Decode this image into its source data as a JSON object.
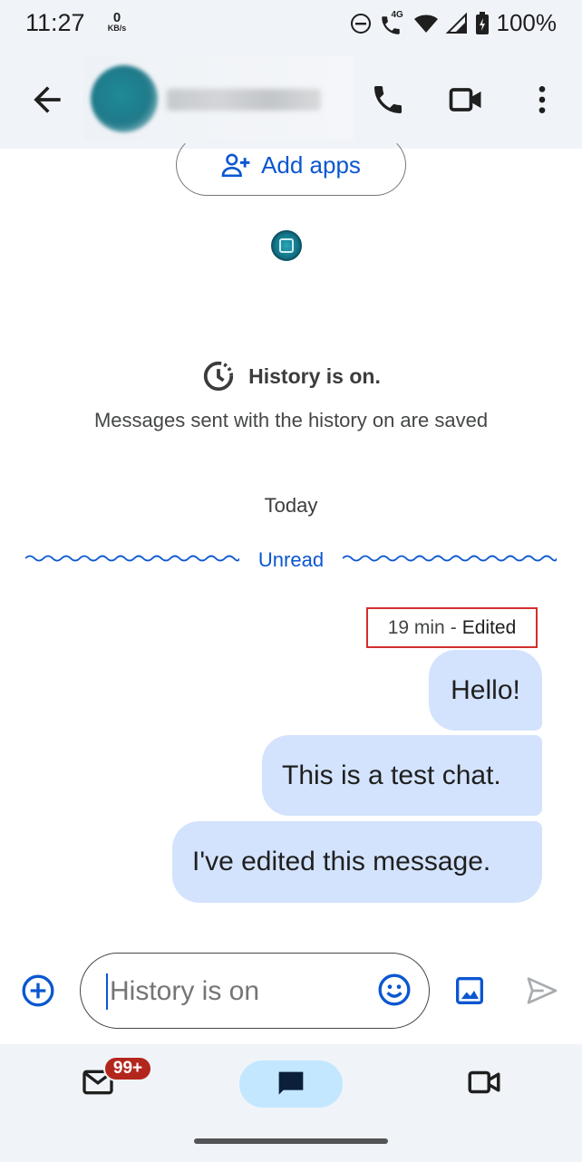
{
  "status_bar": {
    "time": "11:27",
    "net_speed_value": "0",
    "net_speed_unit": "KB/s",
    "network_label": "4G",
    "battery": "100%",
    "icons": [
      "do-not-disturb-icon",
      "wifi-calling-icon",
      "wifi-icon",
      "cell-signal-icon",
      "battery-charging-icon"
    ]
  },
  "header": {
    "back_icon": "arrow-back-icon",
    "actions": [
      "phone-icon",
      "video-call-icon",
      "more-vert-icon"
    ]
  },
  "chat": {
    "add_apps_label": "Add apps",
    "history_title": "History is on.",
    "history_subtitle": "Messages sent with the history on are saved",
    "date_divider": "Today",
    "unread_label": "Unread",
    "message_time": "19 min",
    "message_separator": "-",
    "edited_label": "Edited",
    "messages": [
      "Hello!",
      "This is a test chat.",
      "I've edited this message."
    ]
  },
  "compose": {
    "placeholder": "History is on",
    "value": ""
  },
  "bottom_nav": {
    "mail_badge": "99+",
    "items": [
      "mail-icon",
      "chat-icon",
      "meet-icon"
    ]
  },
  "colors": {
    "accent": "#0b57d0",
    "bubble": "#d3e3fd",
    "surface": "#f0f4f9",
    "badge": "#b3261e",
    "highlight_box": "#d32f2f"
  }
}
